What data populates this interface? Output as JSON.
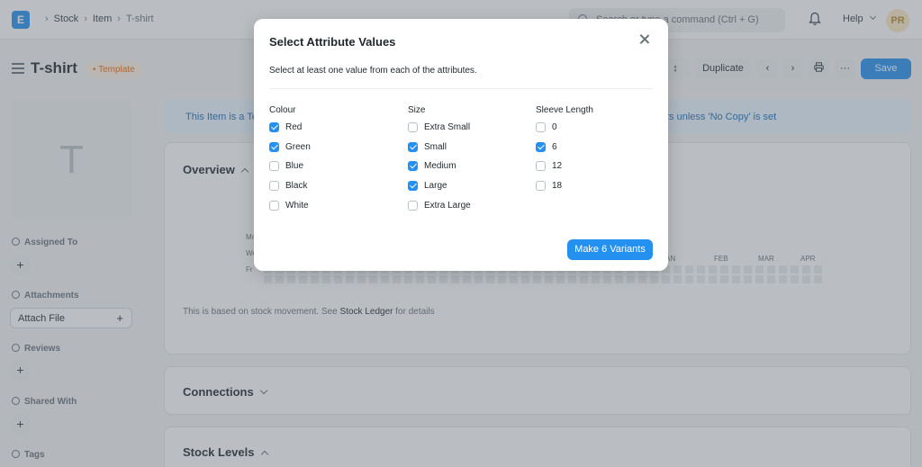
{
  "navbar": {
    "logo_letter": "E",
    "breadcrumbs": [
      "Stock",
      "Item",
      "T-shirt"
    ],
    "search_placeholder": "Search or type a command (Ctrl + G)",
    "help_label": "Help",
    "avatar_initials": "PR"
  },
  "page": {
    "title": "T-shirt",
    "badge": "• Template",
    "buttons": {
      "duplicate": "Duplicate",
      "save": "Save",
      "more": "···"
    }
  },
  "sidebar": {
    "thumbnail_letter": "T",
    "assigned_to": "Assigned To",
    "attachments": "Attachments",
    "attach_file": "Attach File",
    "reviews": "Reviews",
    "shared_with": "Shared With",
    "tags": "Tags",
    "plus": "+"
  },
  "main": {
    "banner_left": "This Item is a Te",
    "banner_right": "ts unless 'No Copy' is set",
    "overview": {
      "title": "Overview",
      "months": [
        "AN",
        "FEB",
        "MAR",
        "APR"
      ],
      "day_labels": [
        "Mo",
        "We",
        "Fr"
      ],
      "footnote_prefix": "This is based on stock movement. See",
      "footnote_link": "Stock Ledger",
      "footnote_suffix": "for details"
    },
    "connections": "Connections",
    "stock_levels": "Stock Levels"
  },
  "modal": {
    "title": "Select Attribute Values",
    "description": "Select at least one value from each of the attributes.",
    "columns": [
      {
        "heading": "Colour",
        "options": [
          {
            "label": "Red",
            "checked": true
          },
          {
            "label": "Green",
            "checked": true
          },
          {
            "label": "Blue",
            "checked": false
          },
          {
            "label": "Black",
            "checked": false
          },
          {
            "label": "White",
            "checked": false
          }
        ]
      },
      {
        "heading": "Size",
        "options": [
          {
            "label": "Extra Small",
            "checked": false
          },
          {
            "label": "Small",
            "checked": true
          },
          {
            "label": "Medium",
            "checked": true
          },
          {
            "label": "Large",
            "checked": true
          },
          {
            "label": "Extra Large",
            "checked": false
          }
        ]
      },
      {
        "heading": "Sleeve Length",
        "options": [
          {
            "label": "0",
            "checked": false
          },
          {
            "label": "6",
            "checked": true
          },
          {
            "label": "12",
            "checked": false
          },
          {
            "label": "18",
            "checked": false
          }
        ]
      }
    ],
    "primary_action": "Make 6 Variants"
  },
  "colors": {
    "accent": "#2490ef",
    "badge_text": "#e86c13",
    "banner_bg": "#e8f4ff"
  }
}
